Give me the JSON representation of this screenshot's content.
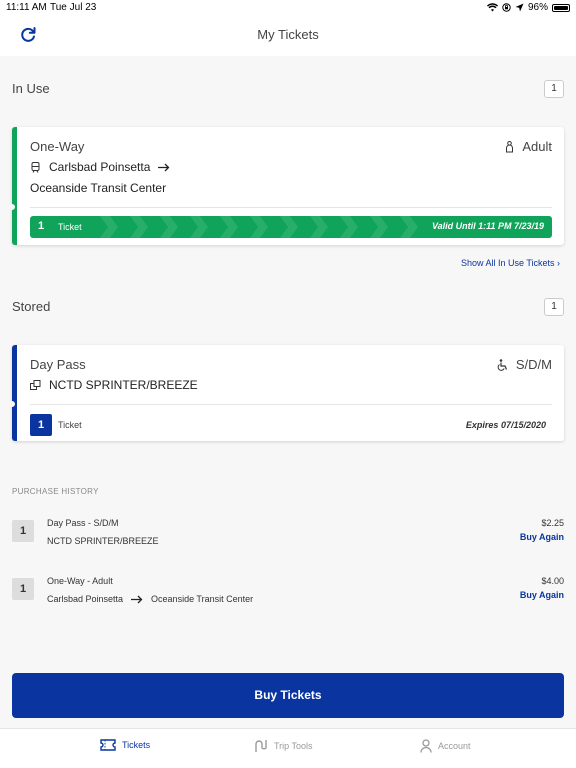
{
  "status_bar": {
    "time": "11:11 AM",
    "date": "Tue Jul 23",
    "battery": "96%",
    "battery_level": 0.96
  },
  "nav": {
    "title": "My Tickets"
  },
  "in_use": {
    "title": "In Use",
    "count": "1",
    "ticket": {
      "type": "One-Way",
      "rider": "Adult",
      "origin": "Carlsbad Poinsetta",
      "destination": "Oceanside Transit Center",
      "quantity": "1",
      "label": "Ticket",
      "validity": "Valid Until 1:11 PM 7/23/19"
    },
    "show_all": "Show All In Use Tickets ›"
  },
  "stored": {
    "title": "Stored",
    "count": "1",
    "ticket": {
      "type": "Day Pass",
      "rider": "S/D/M",
      "service": "NCTD SPRINTER/BREEZE",
      "quantity": "1",
      "label": "Ticket",
      "expires": "Expires 07/15/2020"
    }
  },
  "purchase_history": {
    "title": "PURCHASE HISTORY",
    "items": [
      {
        "quantity": "1",
        "line1": "Day Pass  -  S/D/M",
        "line2": "NCTD SPRINTER/BREEZE",
        "price": "$2.25",
        "action": "Buy Again"
      },
      {
        "quantity": "1",
        "line1": "One-Way  -  Adult",
        "origin": "Carlsbad Poinsetta",
        "destination": "Oceanside Transit Center",
        "price": "$4.00",
        "action": "Buy Again"
      }
    ]
  },
  "buy_button": "Buy Tickets",
  "tabs": [
    {
      "label": "Tickets",
      "icon": "ticket-icon",
      "active": true
    },
    {
      "label": "Trip Tools",
      "icon": "route-icon",
      "active": false
    },
    {
      "label": "Account",
      "icon": "person-icon",
      "active": false
    }
  ],
  "colors": {
    "brand_blue": "#0a35a0",
    "in_use_green": "#10a35a",
    "stored_blue": "#0a35a0"
  }
}
